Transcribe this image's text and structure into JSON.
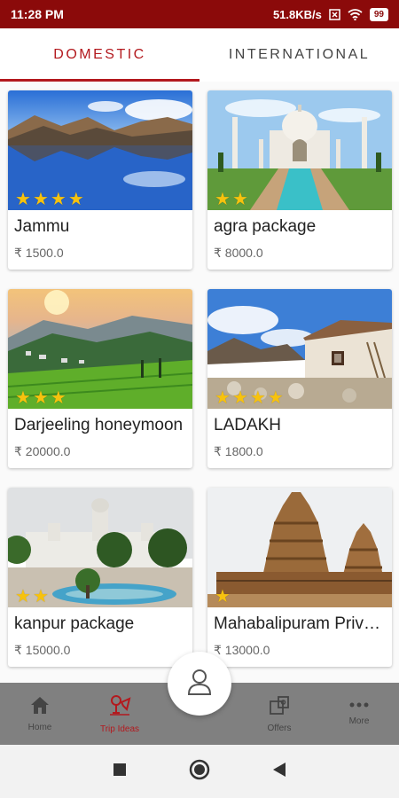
{
  "status": {
    "time": "11:28 PM",
    "speed": "51.8KB/s",
    "battery": "99"
  },
  "tabs": [
    {
      "label": "DOMESTIC"
    },
    {
      "label": "INTERNATIONAL"
    }
  ],
  "cards": [
    {
      "title": "Jammu",
      "price": "₹ 1500.0",
      "stars": 4
    },
    {
      "title": "agra package",
      "price": "₹ 8000.0",
      "stars": 2
    },
    {
      "title": "Darjeeling honeymoon",
      "price": "₹ 20000.0",
      "stars": 3
    },
    {
      "title": "LADAKH",
      "price": "₹ 1800.0",
      "stars": 4
    },
    {
      "title": "kanpur package",
      "price": "₹ 15000.0",
      "stars": 2
    },
    {
      "title": "Mahabalipuram Private",
      "price": "₹ 13000.0",
      "stars": 1
    }
  ],
  "nav": [
    {
      "label": "Home"
    },
    {
      "label": "Trip Ideas"
    },
    {
      "label": "Offers"
    },
    {
      "label": "More"
    }
  ],
  "colors": {
    "accent": "#b3191e",
    "statusbar": "#8b0a0a",
    "star": "#f7c20e",
    "bottomnav": "#808080"
  }
}
